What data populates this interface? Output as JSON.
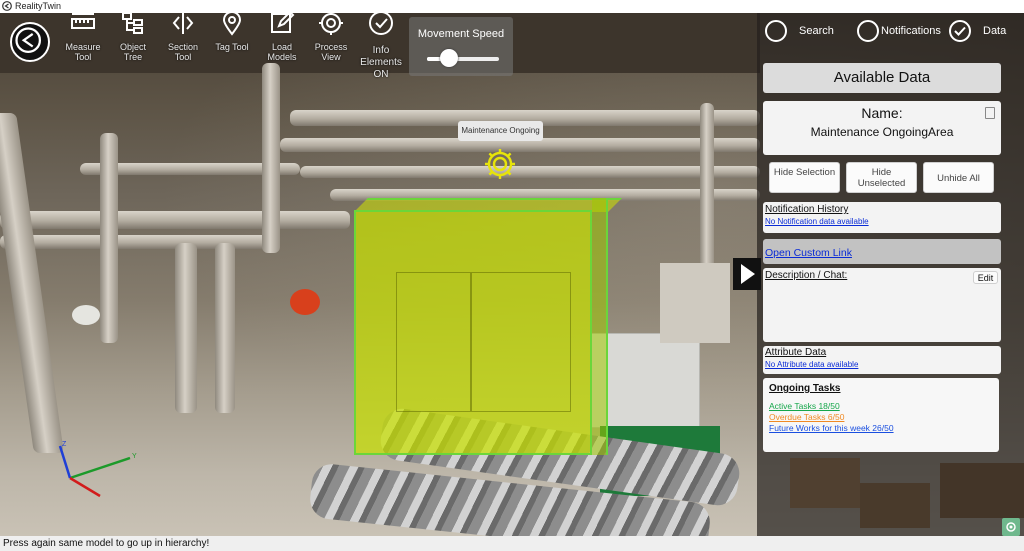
{
  "window": {
    "title": "RealityTwin"
  },
  "toolbar": {
    "buttons": [
      {
        "label": "Measure Tool"
      },
      {
        "label": "Object Tree"
      },
      {
        "label": "Section Tool"
      },
      {
        "label": "Tag Tool"
      },
      {
        "label": "Load Models"
      },
      {
        "label": "Process View"
      },
      {
        "label": "Info Elements ON"
      }
    ],
    "movement_speed": {
      "label": "Movement Speed",
      "value": 0.3
    }
  },
  "scene": {
    "tag_label": "Maintenance Ongoing",
    "colors": {
      "highlight": "#c8e100",
      "outline": "#6bd63a"
    }
  },
  "nav": {
    "search": "Search",
    "notifications": "Notifications",
    "data": "Data"
  },
  "panel": {
    "available_data_title": "Available Data",
    "name_label": "Name:",
    "name_value": "Maintenance OngoingArea",
    "buttons": {
      "hide_selection": "Hide Selection",
      "hide_unselected": "Hide Unselected",
      "unhide_all": "Unhide All"
    },
    "notification_history": {
      "title": "Notification History",
      "empty": "No Notification data available"
    },
    "custom_link": "Open Custom Link",
    "description": {
      "title": "Description / Chat:",
      "edit_label": "Edit"
    },
    "attribute_data": {
      "title": "Attribute Data",
      "empty": "No Attribute data available"
    },
    "ongoing_tasks": {
      "title": "Ongoing Tasks",
      "active": "Active Tasks 18/50",
      "overdue": "Overdue Tasks 6/50",
      "future": "Future Works for this week 26/50",
      "colors": {
        "active": "#15a64a",
        "overdue": "#f08a24",
        "future": "#1a4fe0"
      }
    }
  },
  "status": {
    "message": "Press again same model to go up in hierarchy!"
  }
}
